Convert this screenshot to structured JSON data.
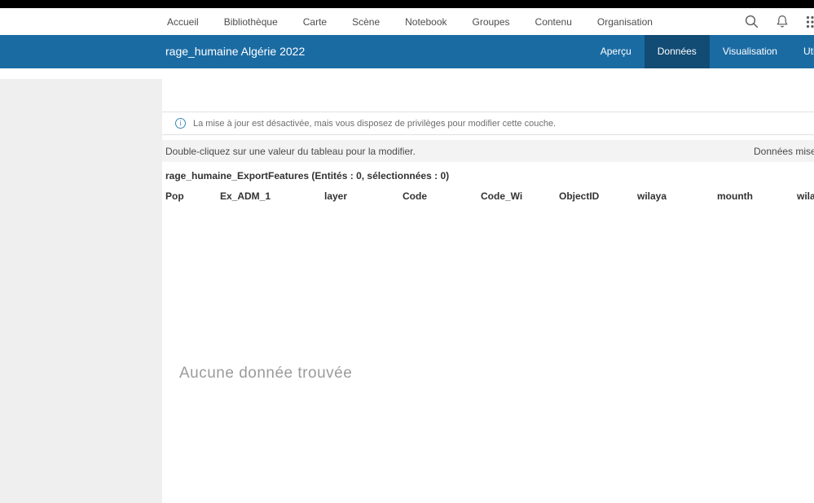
{
  "nav": {
    "items": [
      "Accueil",
      "Bibliothèque",
      "Carte",
      "Scène",
      "Notebook",
      "Groupes",
      "Contenu",
      "Organisation"
    ]
  },
  "header": {
    "title": "rage_humaine Algérie 2022",
    "tabs": [
      {
        "label": "Aperçu",
        "active": false
      },
      {
        "label": "Données",
        "active": true
      },
      {
        "label": "Visualisation",
        "active": false
      },
      {
        "label": "Utilisation",
        "active": false
      }
    ]
  },
  "banner": {
    "text": "La mise à jour est désactivée, mais vous disposez de privilèges pour modifier cette couche."
  },
  "instructions": {
    "left": "Double-cliquez sur une valeur du tableau pour la modifier.",
    "right": "Données mises"
  },
  "table": {
    "title": "rage_humaine_ExportFeatures (Entités : 0, sélectionnées : 0)",
    "columns": [
      "Pop",
      "Ex_ADM_1",
      "layer",
      "Code",
      "Code_Wi",
      "ObjectID",
      "wilaya",
      "mounth",
      "wilaya"
    ],
    "empty_text": "Aucune donnée trouvée"
  },
  "colors": {
    "header-blue": "#1b6ba3",
    "tab-active": "#124b74",
    "sidebar-gray": "#efefef",
    "strip-gray": "#f3f3f3",
    "info-blue": "#3a87b5"
  }
}
